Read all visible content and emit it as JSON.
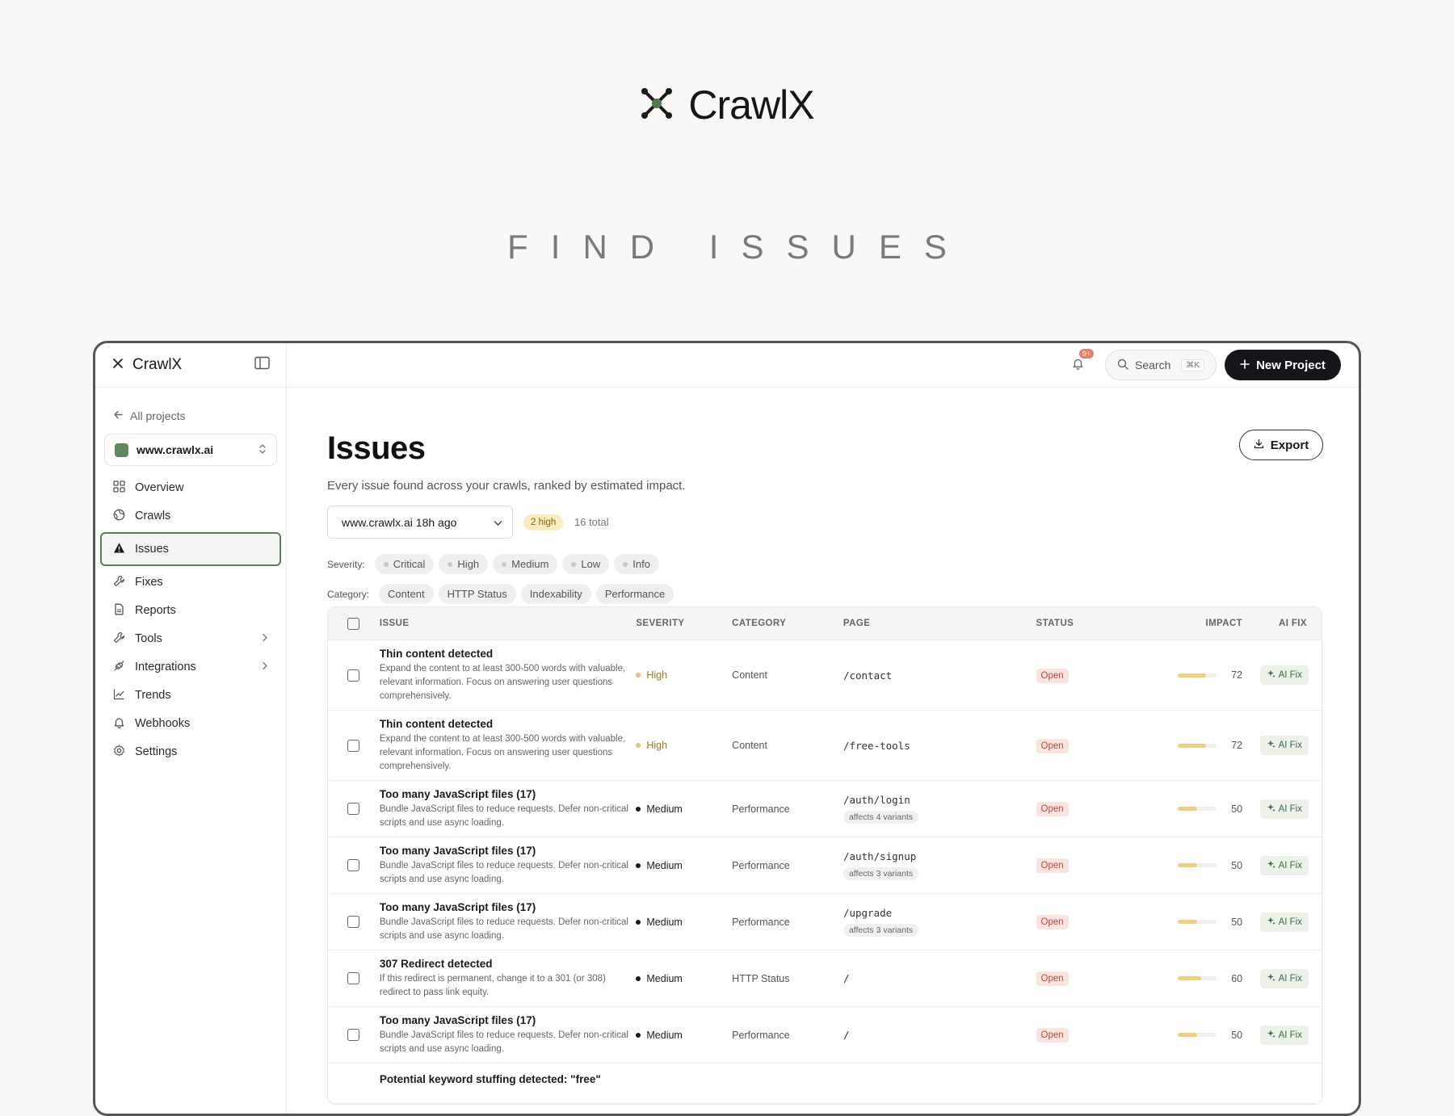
{
  "hero": {
    "brand": "CrawlX",
    "tagline": "FIND ISSUES"
  },
  "sidebar": {
    "brand": "CrawlX",
    "back_label": "All projects",
    "project": "www.crawlx.ai",
    "items": [
      {
        "label": "Overview",
        "icon": "grid-icon"
      },
      {
        "label": "Crawls",
        "icon": "globe-icon"
      },
      {
        "label": "Issues",
        "icon": "warning-icon",
        "active": true
      },
      {
        "label": "Fixes",
        "icon": "wrench-icon"
      },
      {
        "label": "Reports",
        "icon": "document-icon"
      },
      {
        "label": "Tools",
        "icon": "wrench-icon",
        "has_children": true
      },
      {
        "label": "Integrations",
        "icon": "plug-icon",
        "has_children": true
      },
      {
        "label": "Trends",
        "icon": "trend-icon"
      },
      {
        "label": "Webhooks",
        "icon": "bell-icon"
      },
      {
        "label": "Settings",
        "icon": "gear-icon"
      }
    ]
  },
  "topbar": {
    "notif_count": "9+",
    "search_label": "Search",
    "search_kbd": "⌘K",
    "new_project_label": "New Project"
  },
  "main": {
    "title": "Issues",
    "subtitle": "Every issue found across your crawls, ranked by estimated impact.",
    "export_label": "Export",
    "crawl_select": "www.crawlx.ai 18h ago",
    "high_pill": "2 high",
    "total": "16 total",
    "severity_label": "Severity:",
    "severity_chips": [
      "Critical",
      "High",
      "Medium",
      "Low",
      "Info"
    ],
    "category_label": "Category:",
    "category_chips": [
      "Content",
      "HTTP Status",
      "Indexability",
      "Performance"
    ]
  },
  "table": {
    "headers": {
      "issue": "ISSUE",
      "severity": "SEVERITY",
      "category": "CATEGORY",
      "page": "PAGE",
      "status": "STATUS",
      "impact": "IMPACT",
      "ai_fix": "AI FIX"
    },
    "ai_fix_label": "AI Fix",
    "rows": [
      {
        "title": "Thin content detected",
        "desc": "Expand the content to at least 300-500 words with valuable, relevant information. Focus on answering user questions comprehensively.",
        "severity": "High",
        "category": "Content",
        "page": "/contact",
        "variants": "",
        "status": "Open",
        "impact": 72
      },
      {
        "title": "Thin content detected",
        "desc": "Expand the content to at least 300-500 words with valuable, relevant information. Focus on answering user questions comprehensively.",
        "severity": "High",
        "category": "Content",
        "page": "/free-tools",
        "variants": "",
        "status": "Open",
        "impact": 72
      },
      {
        "title": "Too many JavaScript files (17)",
        "desc": "Bundle JavaScript files to reduce requests. Defer non-critical scripts and use async loading.",
        "severity": "Medium",
        "category": "Performance",
        "page": "/auth/login",
        "variants": "affects 4 variants",
        "status": "Open",
        "impact": 50
      },
      {
        "title": "Too many JavaScript files (17)",
        "desc": "Bundle JavaScript files to reduce requests. Defer non-critical scripts and use async loading.",
        "severity": "Medium",
        "category": "Performance",
        "page": "/auth/signup",
        "variants": "affects 3 variants",
        "status": "Open",
        "impact": 50
      },
      {
        "title": "Too many JavaScript files (17)",
        "desc": "Bundle JavaScript files to reduce requests. Defer non-critical scripts and use async loading.",
        "severity": "Medium",
        "category": "Performance",
        "page": "/upgrade",
        "variants": "affects 3 variants",
        "status": "Open",
        "impact": 50
      },
      {
        "title": "307 Redirect detected",
        "desc": "If this redirect is permanent, change it to a 301 (or 308) redirect to pass link equity.",
        "severity": "Medium",
        "category": "HTTP Status",
        "page": "/",
        "variants": "",
        "status": "Open",
        "impact": 60
      },
      {
        "title": "Too many JavaScript files (17)",
        "desc": "Bundle JavaScript files to reduce requests. Defer non-critical scripts and use async loading.",
        "severity": "Medium",
        "category": "Performance",
        "page": "/",
        "variants": "",
        "status": "Open",
        "impact": 50
      },
      {
        "title": "Potential keyword stuffing detected: \"free\"",
        "desc": "",
        "severity": "",
        "category": "",
        "page": "",
        "variants": "",
        "status": "",
        "impact": null
      }
    ]
  }
}
